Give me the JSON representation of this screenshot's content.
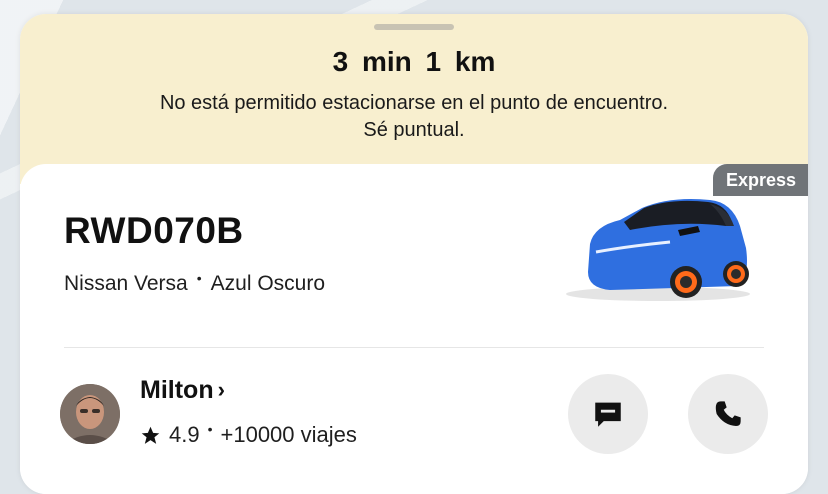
{
  "eta": "3 min  1 km",
  "notice": {
    "line1": "No está permitido estacionarse en el punto de encuentro.",
    "line2": "Sé puntual."
  },
  "vehicle": {
    "tier": "Express",
    "plate": "RWD070B",
    "model": "Nissan Versa",
    "color": "Azul Oscuro",
    "car_color": "#2f6fe0"
  },
  "driver": {
    "name": "Milton",
    "rating": "4.9",
    "trips": "+10000 viajes"
  },
  "actions": {
    "message_icon": "message-icon",
    "call_icon": "phone-icon"
  },
  "colors": {
    "banner": "#f8efcf",
    "tier_badge": "#707478",
    "action_button": "#ebebeb"
  }
}
